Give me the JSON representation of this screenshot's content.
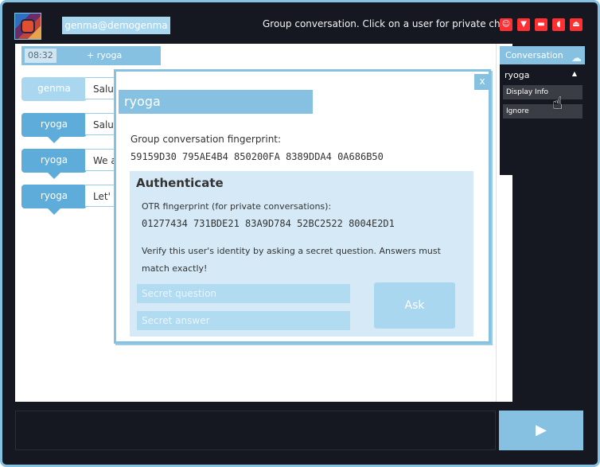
{
  "header": {
    "user": "genma@demogenma",
    "hint": "Group conversation. Click on a user for private chat.",
    "icons": [
      "smiley-icon",
      "filter-icon",
      "chat-icon",
      "sound-icon",
      "eject-icon"
    ]
  },
  "conversation": {
    "time": "08:32",
    "channel_prefix": "+",
    "channel": "ryoga",
    "messages": [
      {
        "nick": "genma",
        "text": "Salu"
      },
      {
        "nick": "ryoga",
        "text": "Salu"
      },
      {
        "nick": "ryoga",
        "text": "We a"
      },
      {
        "nick": "ryoga",
        "text": "Let'"
      }
    ]
  },
  "sidebar": {
    "title": "Conversation",
    "user": "ryoga",
    "menu": [
      "Display Info",
      "Ignore"
    ]
  },
  "modal": {
    "title": "ryoga",
    "close": "x",
    "group_label": "Group conversation fingerprint:",
    "group_fingerprint": "59159D30 795AE4B4 850200FA 8389DDA4 0A686B50",
    "auth_heading": "Authenticate",
    "otr_label": "OTR fingerprint (for private conversations):",
    "otr_fingerprint": "01277434 731BDE21 83A9D784 52BC2522 8004E2D1",
    "verify_text": "Verify this user's identity by asking a secret question. Answers must match exactly!",
    "question_placeholder": "Secret question",
    "answer_placeholder": "Secret answer",
    "ask": "Ask"
  },
  "compose": {
    "send": "▶"
  }
}
